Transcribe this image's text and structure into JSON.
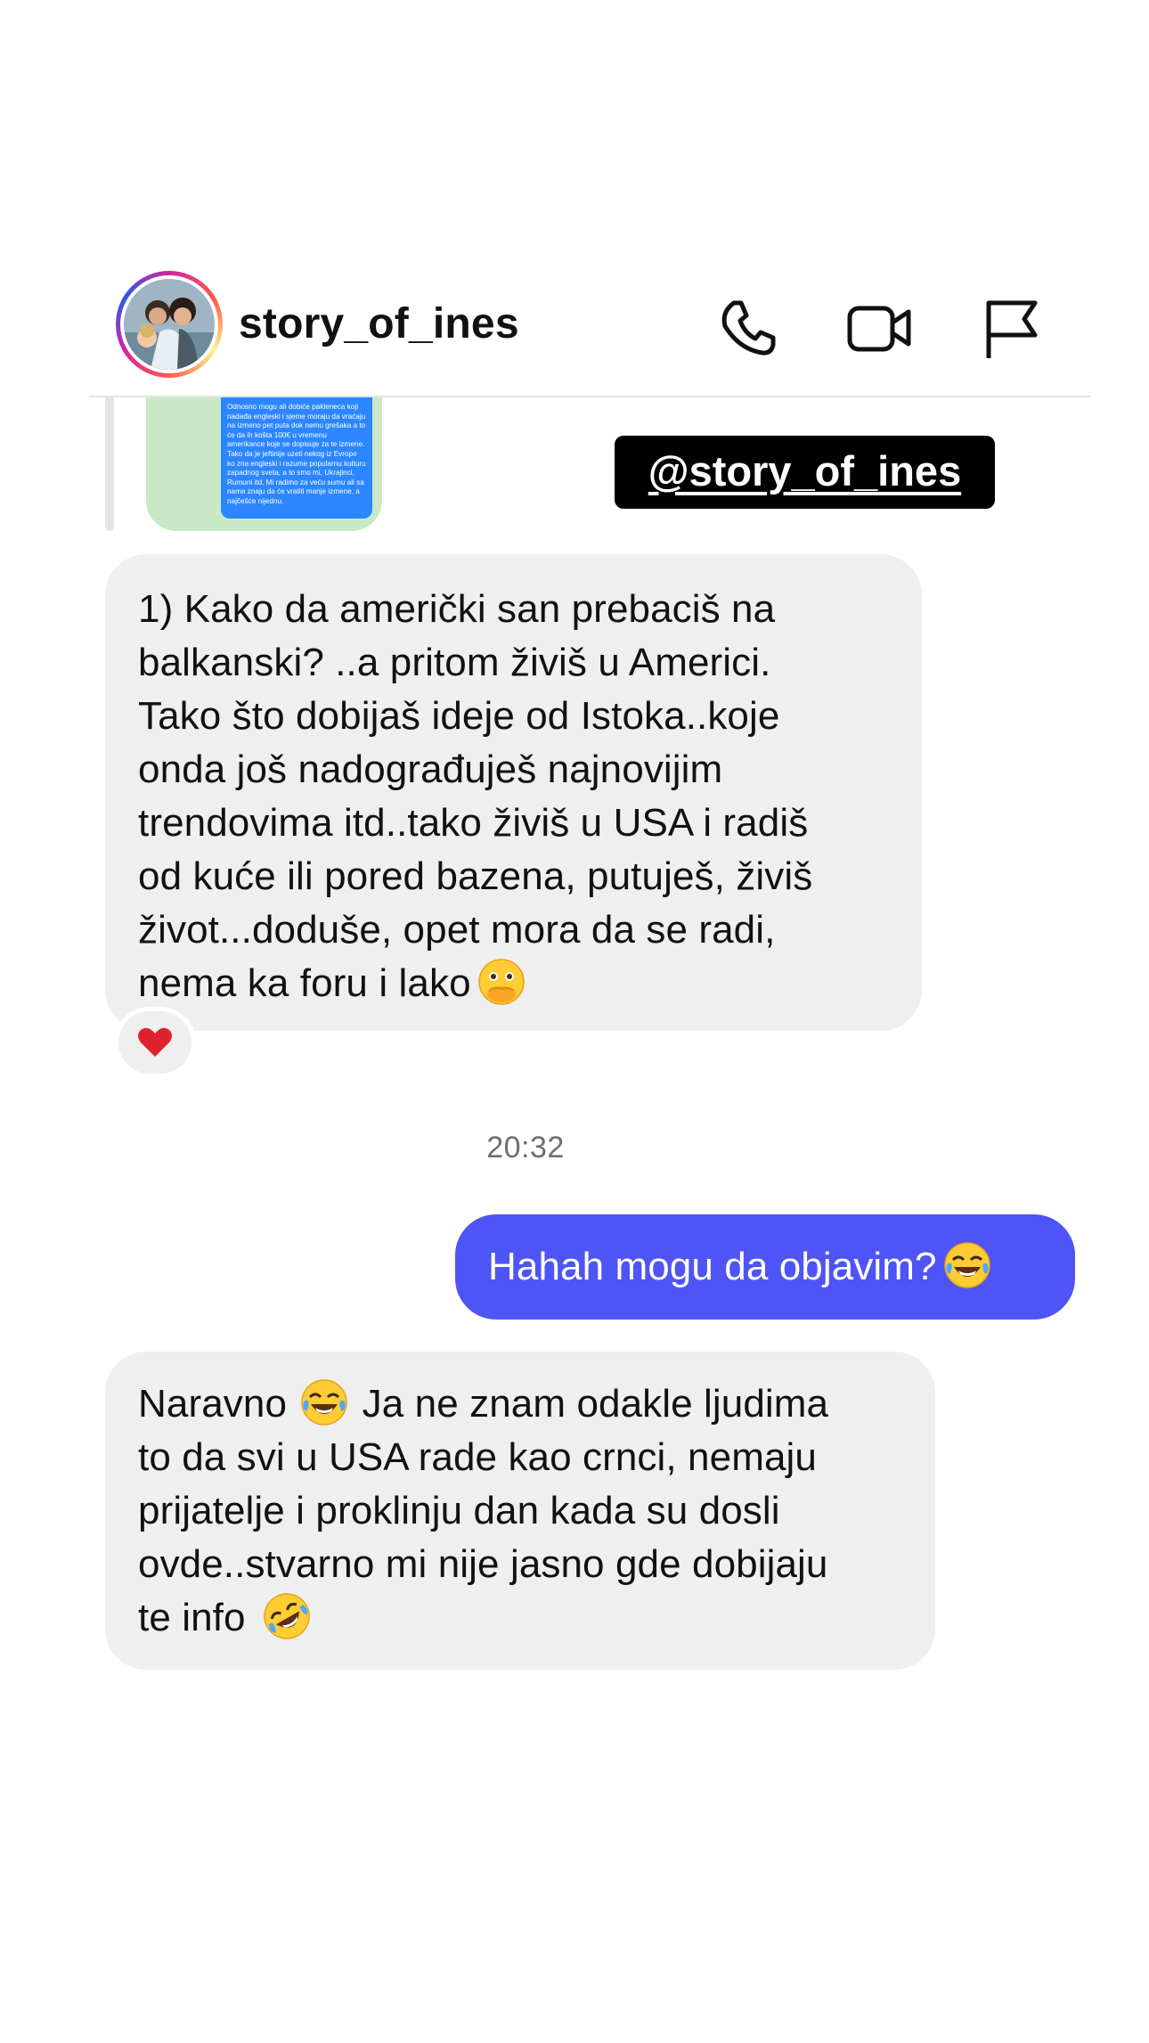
{
  "header": {
    "username": "story_of_ines",
    "avatar_icon": "profile-photo",
    "call_icon": "phone-icon",
    "video_icon": "video-camera-icon",
    "report_icon": "flag-icon"
  },
  "shared_post": {
    "preview_text": "Odnosno mogu ali dobiće pakleneca koji nadađa engleski i sjeme moraju da vraćaju na izmeno pet puta dok nemu grešaka a to će da ih košta 100€ u vremenu amerikance koje se dopisuje za te izmene. Tako da je jeftinije uzeti nekog iz Evrope ko zna engleski i razume popularnu kulturu zapadnog sveta, a to smo mi, Ukrajinci, Rumuni itd. Mi radimo za veću sumu ali sa nama znaju da će vratiti manje izmene, a najčešće nijednu.",
    "story_tag": "@story_of_ines"
  },
  "messages": [
    {
      "direction": "incoming",
      "text": "1) Kako da američki san prebaciš na\nbalkanski? ..a pritom živiš u Americi.\nTako što dobijaš ideje od Istoka..koje\nonda još nadograđuješ najnovijim\ntrendovima itd..tako živiš u USA i radiš\nod kuće ili pored bazena, putuješ, živiš\nživot...doduše, opet mora da se radi,\nnema ka foru i lako",
      "emoji": "face-with-open-eyes-and-hand-over-mouth",
      "reaction": "heart"
    },
    {
      "direction": "outgoing",
      "text": "Hahah mogu da objavim?",
      "emoji": "face-with-tears-of-joy"
    },
    {
      "direction": "incoming",
      "text_part1": "Naravno",
      "emoji_inline": "face-with-tears-of-joy",
      "text_part2": " Ja ne znam odakle ljudima\nto da svi u USA rade kao crnci, nemaju\nprijatelje i proklinju dan kada su dosli\novde..stvarno mi nije jasno gde dobijaju\nte info ",
      "emoji": "rolling-on-the-floor-laughing"
    }
  ],
  "timestamp": "20:32",
  "colors": {
    "outgoing_bubble": "#4e54f6",
    "incoming_bubble": "#efefef",
    "reaction_heart": "#e0222c"
  }
}
